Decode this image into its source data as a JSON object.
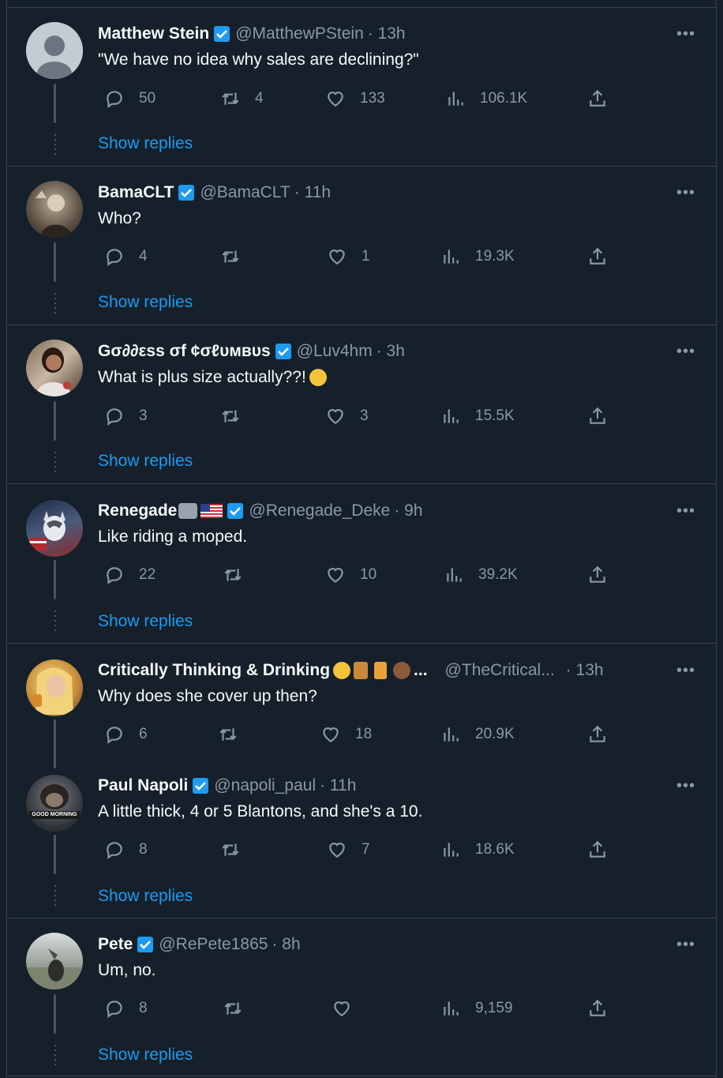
{
  "tweets": [
    {
      "name": "Matthew Stein",
      "handle": "@MatthewPStein",
      "time": "· 13h",
      "text": "\"We have no idea why sales are declining?\"",
      "replies": "50",
      "retweets": "4",
      "likes": "133",
      "views": "106.1K",
      "show_replies": "Show replies",
      "avatar": "gray-default"
    },
    {
      "name": "BamaCLT",
      "handle": "@BamaCLT",
      "time": "· 11h",
      "text": "Who?",
      "replies": "4",
      "retweets": "",
      "likes": "1",
      "views": "19.3K",
      "show_replies": "Show replies",
      "avatar": "sepia-portrait"
    },
    {
      "name": "Gσ∂∂εss σf ¢σℓυмвυs",
      "handle": "@Luv4hm",
      "time": "· 3h",
      "text": "What is plus size actually??!",
      "replies": "3",
      "retweets": "",
      "likes": "3",
      "views": "15.5K",
      "show_replies": "Show replies",
      "avatar": "woman-photo"
    },
    {
      "name": "Renegade",
      "handle": "@Renegade_Deke",
      "time": "· 9h",
      "text": "Like riding a moped.",
      "replies": "22",
      "retweets": "",
      "likes": "10",
      "views": "39.2K",
      "show_replies": "Show replies",
      "avatar": "husky-flag"
    },
    {
      "name": "Critically Thinking & Drinking",
      "handle": "@TheCritical...",
      "time": "· 13h",
      "text": "Why does she cover up then?",
      "replies": "6",
      "retweets": "",
      "likes": "18",
      "views": "20.9K",
      "show_replies": "",
      "avatar": "blonde-woman"
    },
    {
      "name": "Paul Napoli",
      "handle": "@napoli_paul",
      "time": "· 11h",
      "text": "A little thick, 4 or 5 Blantons, and she's a 10.",
      "replies": "8",
      "retweets": "",
      "likes": "7",
      "views": "18.6K",
      "show_replies": "Show replies",
      "avatar": "chimp",
      "avatar_caption": "GOOD MORNING"
    },
    {
      "name": "Pete",
      "handle": "@RePete1865",
      "time": "· 8h",
      "text": "Um, no.",
      "replies": "8",
      "retweets": "",
      "likes": "",
      "views": "9,159",
      "show_replies": "Show replies",
      "avatar": "landscape"
    }
  ],
  "colors": {
    "background": "#15202b",
    "text": "#f7f9f9",
    "muted": "#8b98a5",
    "accent": "#1d9bf0",
    "verified": "#1d9bf0",
    "border": "#38444d"
  },
  "icons": {
    "reply": "reply-icon",
    "retweet": "retweet-icon",
    "like": "heart-icon",
    "views": "views-icon",
    "share": "share-icon",
    "verified": "verified-badge-icon",
    "more": "more-icon"
  }
}
